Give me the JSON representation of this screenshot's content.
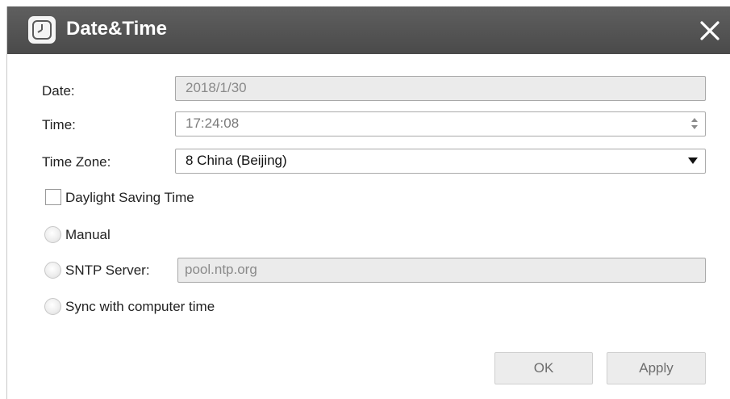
{
  "dialog": {
    "title": "Date&Time",
    "title_icon": "clock-icon",
    "close_icon": "close-icon"
  },
  "form": {
    "date_label": "Date:",
    "date_value": "2018/1/30",
    "time_label": "Time:",
    "time_value": "17:24:08",
    "timezone_label": "Time Zone:",
    "timezone_value": "8 China (Beijing)",
    "dst_label": "Daylight Saving Time",
    "dst_checked": false,
    "manual_label": "Manual",
    "sntp_label": "SNTP Server:",
    "sntp_value": "pool.ntp.org",
    "sync_label": "Sync with computer time"
  },
  "buttons": {
    "ok_label": "OK",
    "apply_label": "Apply"
  },
  "colors": {
    "titlebar": "#555555",
    "disabled_field": "#ebebeb"
  }
}
